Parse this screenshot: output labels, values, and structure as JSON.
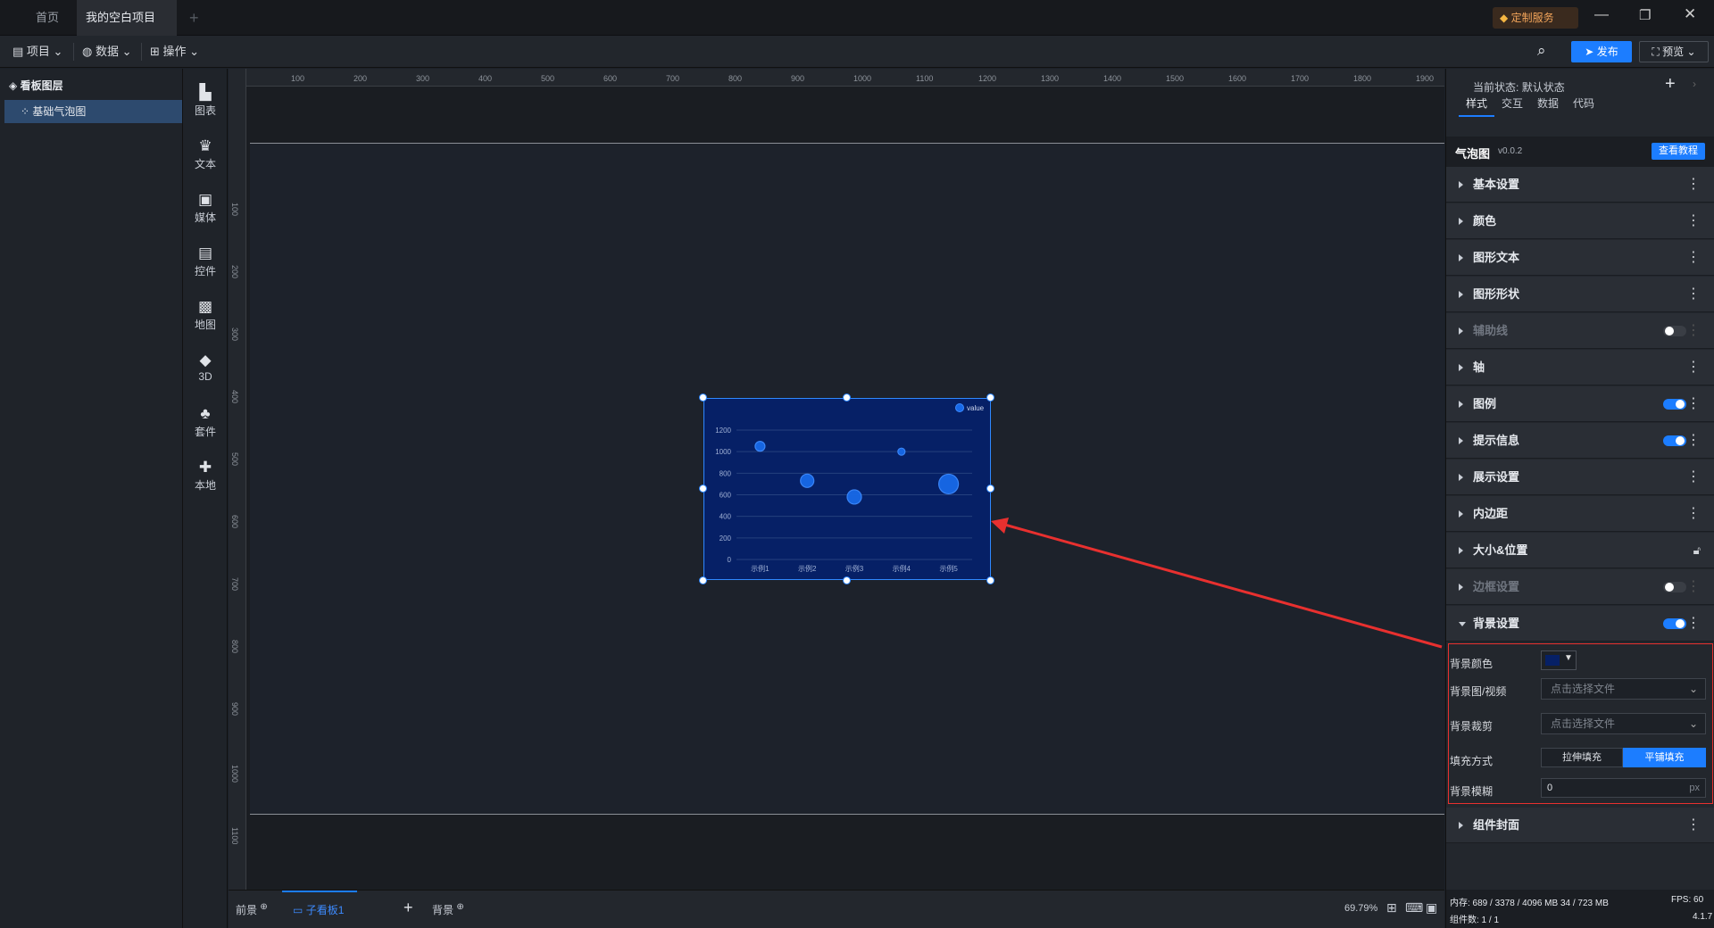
{
  "tabs": {
    "home": "首页",
    "project": "我的空白项目",
    "custom_service": "定制服务"
  },
  "menu": {
    "project": "项目",
    "data": "数据",
    "operate": "操作",
    "publish": "发布",
    "preview": "预览"
  },
  "layers": {
    "title": "看板图层",
    "item": "基础气泡图"
  },
  "toolbox": [
    {
      "label": "图表",
      "icon": "bar-chart-icon"
    },
    {
      "label": "文本",
      "icon": "text-icon"
    },
    {
      "label": "媒体",
      "icon": "media-icon"
    },
    {
      "label": "控件",
      "icon": "control-icon"
    },
    {
      "label": "地图",
      "icon": "map-icon"
    },
    {
      "label": "3D",
      "icon": "cube-icon"
    },
    {
      "label": "套件",
      "icon": "kit-icon"
    },
    {
      "label": "本地",
      "icon": "puzzle-icon"
    }
  ],
  "ruler": {
    "top": [
      "100",
      "200",
      "300",
      "400",
      "500",
      "600",
      "700",
      "800",
      "900",
      "1000",
      "1100",
      "1200",
      "1300",
      "1400",
      "1500",
      "1600",
      "1700",
      "1800",
      "1900"
    ],
    "left": [
      "100",
      "200",
      "300",
      "400",
      "500",
      "600",
      "700",
      "800",
      "900",
      "1000",
      "1100"
    ]
  },
  "chart_data": {
    "type": "scatter",
    "categories": [
      "示例1",
      "示例2",
      "示例3",
      "示例4",
      "示例5"
    ],
    "series": [
      {
        "name": "value",
        "values": [
          1050,
          730,
          580,
          1000,
          700
        ],
        "sizes": [
          7,
          11,
          12,
          4,
          18
        ]
      }
    ],
    "yticks": [
      "1200",
      "1000",
      "800",
      "600",
      "400",
      "200",
      "0"
    ],
    "ylim": [
      0,
      1200
    ],
    "legend": "top-right",
    "colors": {
      "bg": "#062066",
      "point": "#1769e8"
    }
  },
  "bottom": {
    "front": "前景",
    "board": "子看板1",
    "back": "背景",
    "zoom": "69.79%"
  },
  "right": {
    "state_label": "当前状态:",
    "state_value": "默认状态",
    "tabs": [
      "样式",
      "交互",
      "数据",
      "代码"
    ],
    "comp_name": "气泡图",
    "version": "v0.0.2",
    "tutorial": "查看教程",
    "sections": [
      "基本设置",
      "颜色",
      "图形文本",
      "图形形状",
      "辅助线",
      "轴",
      "图例",
      "提示信息",
      "展示设置",
      "内边距",
      "大小&位置",
      "边框设置",
      "背景设置"
    ],
    "bg": {
      "color_label": "背景颜色",
      "img_label": "背景图/视频",
      "img_placeholder": "点击选择文件",
      "crop_label": "背景裁剪",
      "crop_placeholder": "点击选择文件",
      "fill_label": "填充方式",
      "fill_stretch": "拉伸填充",
      "fill_tile": "平铺填充",
      "blur_label": "背景模糊",
      "blur_value": "0",
      "blur_unit": "px"
    },
    "cover": "组件封面"
  },
  "status": {
    "memory": "内存: 689 / 3378 / 4096 MB 34 / 723 MB",
    "fps": "FPS: 60",
    "count": "组件数: 1 / 1",
    "ver": "4.1.7"
  }
}
